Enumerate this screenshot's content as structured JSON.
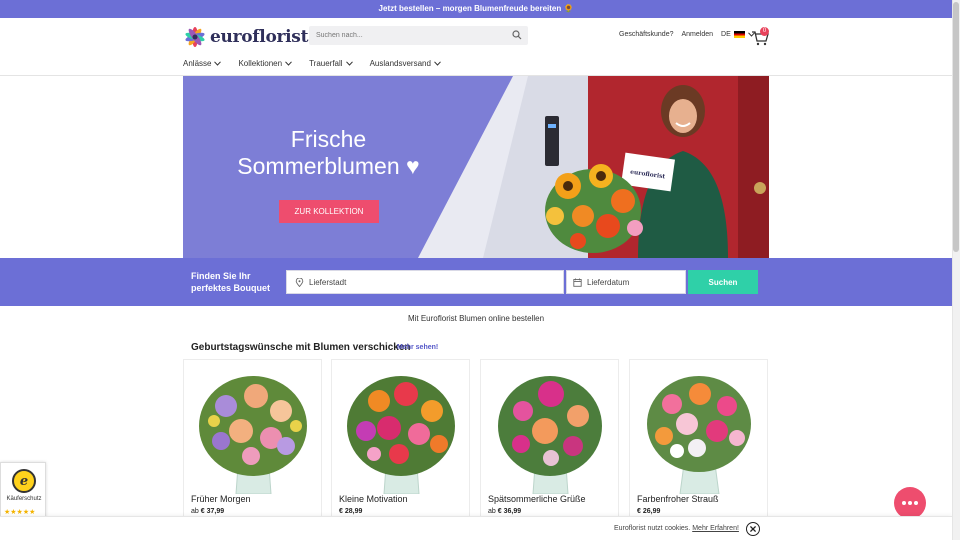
{
  "announcement": "Jetzt bestellen – morgen Blumenfreude bereiten 🌻",
  "header": {
    "logo_text": "euroflorist",
    "search_placeholder": "Suchen nach...",
    "links": [
      "Geschäftskunde?",
      "Anmelden"
    ],
    "language": "DE",
    "cart_count": "0"
  },
  "nav": [
    {
      "label": "Anlässe"
    },
    {
      "label": "Kollektionen"
    },
    {
      "label": "Trauerfall"
    },
    {
      "label": "Auslandsversand"
    }
  ],
  "hero": {
    "title_line1": "Frische",
    "title_line2": "Sommerblumen ♥",
    "button_label": "ZUR KOLLEKTION",
    "card_text": "euroflorist"
  },
  "finder": {
    "label": "Finden Sie Ihr perfektes Bouquet",
    "city_placeholder": "Lieferstadt",
    "date_placeholder": "Lieferdatum",
    "button_label": "Suchen"
  },
  "tagline": "Mit Euroflorist Blumen online bestellen",
  "section": {
    "title": "Geburtstagswünsche mit Blumen verschicken",
    "more_link": "Mehr sehen!"
  },
  "products": [
    {
      "name": "Früher Morgen",
      "prefix": "ab",
      "price": "€ 37,99"
    },
    {
      "name": "Kleine Motivation",
      "prefix": "",
      "price": "€ 28,99"
    },
    {
      "name": "Spätsommerliche Grüße",
      "prefix": "ab",
      "price": "€ 36,99"
    },
    {
      "name": "Farbenfroher Strauß",
      "prefix": "",
      "price": "€ 26,99"
    }
  ],
  "trust": {
    "label": "Käuferschutz",
    "stars": "★★★★★"
  },
  "cookie": {
    "text": "Euroflorist nutzt cookies.",
    "link": "Mehr Erfahren!"
  }
}
